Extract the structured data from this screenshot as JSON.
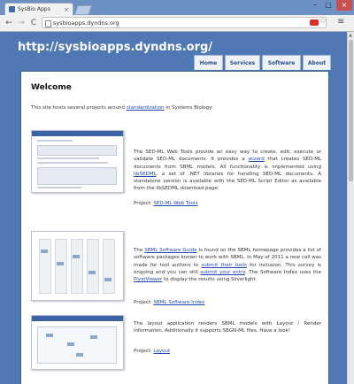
{
  "browser": {
    "tab_title": "SysBio Apps",
    "tab_close": "×",
    "url": "sysbioapps.dyndns.org",
    "win_min": "–",
    "win_max": "□",
    "win_close": "×",
    "back": "←",
    "forward": "→",
    "reload": "C",
    "star": "☆",
    "menu": "≡"
  },
  "site": {
    "title": "http://sysbioapps.dyndns.org/",
    "nav": [
      "Home",
      "Services",
      "Software",
      "About"
    ]
  },
  "main": {
    "heading": "Welcome",
    "intro_before": "This site hosts several projects around ",
    "intro_link": "standardization",
    "intro_after": " in Systems Biology:",
    "projects": [
      {
        "t1": "The SED-ML Web Tools provide an easy way to create, edit, execute or validate SED-ML documents. It provides a ",
        "l1": "wizard",
        "t2": " that creates SED-ML documents from SBML models. All functionality is implemented using ",
        "l2": "libSEDML",
        "t3": ", a set of .NET libraries for handling SED-ML documents. A standalone version is available with the SED-ML Script Editor as available from the libSEDML download page.",
        "proj_label": "Project: ",
        "proj_link": "SED-ML Web Tools"
      },
      {
        "t0": "The ",
        "l0": "SBML Software Guide",
        "t1": " is found on the SBML homepage provides a list of software packages known to work with SBML. In May of 2011 a new call was made for tool authors to ",
        "l1": "submit their tools",
        "t2": " for inclusion. This survey is ongoing and you can still ",
        "l2": "submit your entry",
        "t3": ". The Software Index uses the ",
        "l3": "PivotViewer",
        "t4": " to display the results using Silverlight.",
        "proj_label": "Project: ",
        "proj_link": "SBML Software Index"
      },
      {
        "t1": "The layout application renders SBML models with Layout / Render information. Additionally it supports SBGN-ML files. Have a look!",
        "proj_label": "Project: ",
        "proj_link": "Layout"
      }
    ]
  },
  "colors": {
    "page_bg": "#4f78b4",
    "nav_text": "#2c4f86",
    "link": "#2048b0"
  },
  "icons": [
    "page-icon",
    "extension-icon",
    "star-icon",
    "menu-icon",
    "back-icon",
    "forward-icon",
    "reload-icon"
  ]
}
